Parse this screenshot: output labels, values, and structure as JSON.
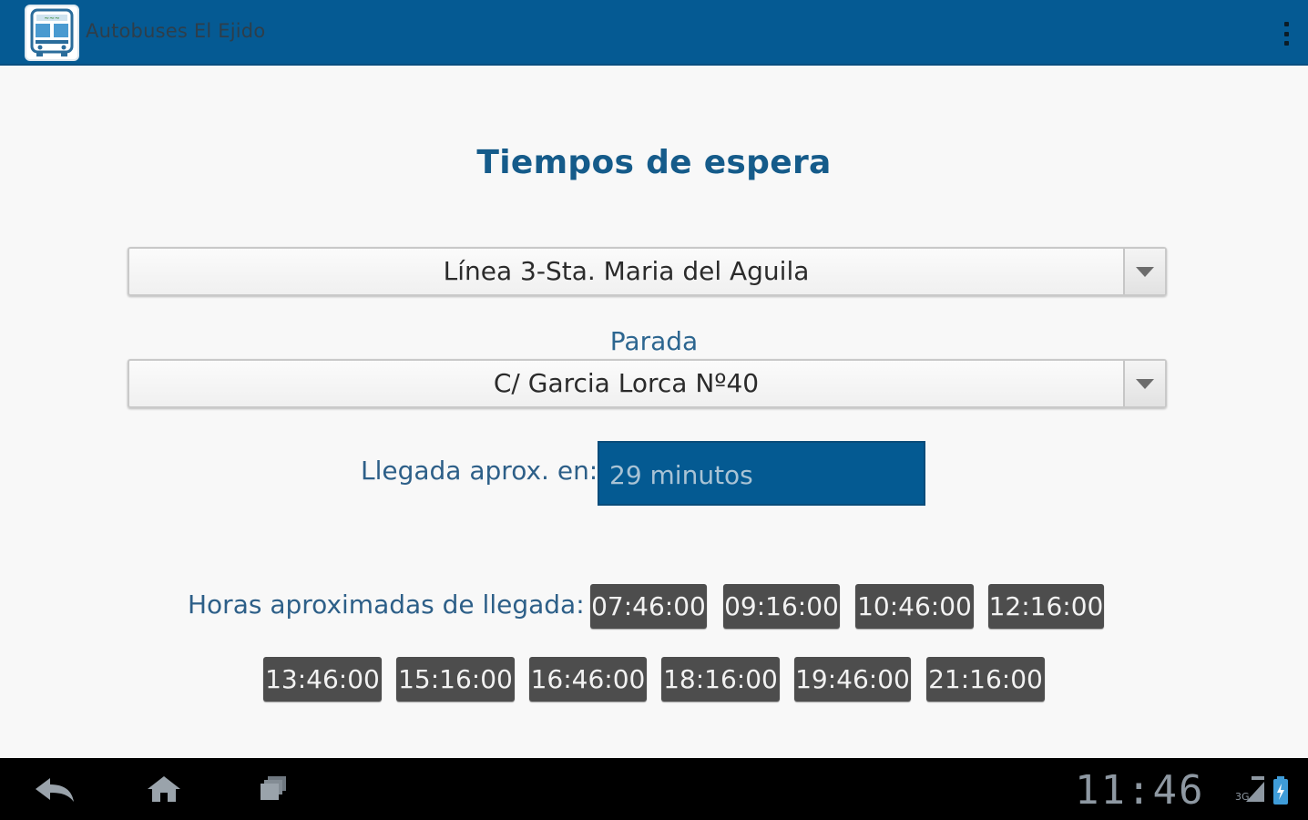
{
  "app": {
    "title": "Autobuses El Ejido",
    "icon": "bus-icon",
    "menu_icon": "overflow-menu-icon"
  },
  "main": {
    "title": "Tiempos de espera",
    "line_spinner": {
      "selected": "Línea 3-Sta. Maria del Aguila"
    },
    "stop_label": "Parada",
    "stop_spinner": {
      "selected": "C/ Garcia Lorca Nº40"
    },
    "arrival": {
      "label": "Llegada aprox. en:",
      "value": "29 minutos"
    },
    "times": {
      "label": "Horas aproximadas de llegada:",
      "values": [
        "07:46:00",
        "09:16:00",
        "10:46:00",
        "12:16:00",
        "13:46:00",
        "15:16:00",
        "16:46:00",
        "18:16:00",
        "19:46:00",
        "21:16:00"
      ]
    }
  },
  "system_bar": {
    "clock": "11:46",
    "network": "3G",
    "icons": [
      "back-icon",
      "home-icon",
      "recent-apps-icon",
      "signal-icon",
      "battery-icon"
    ]
  },
  "colors": {
    "action_bar": "#055a93",
    "title": "#155b8a",
    "accent_box": "#045a92",
    "time_chip": "#4d4d4d",
    "system_bar": "#000000"
  }
}
